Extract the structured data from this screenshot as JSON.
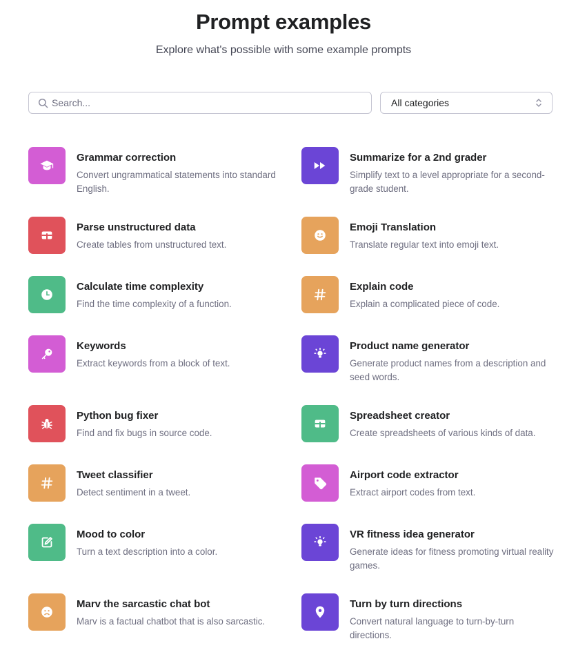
{
  "header": {
    "title": "Prompt examples",
    "subtitle": "Explore what's possible with some example prompts"
  },
  "search": {
    "placeholder": "Search...",
    "value": ""
  },
  "category_filter": {
    "selected": "All categories"
  },
  "colors": {
    "pink": "#d35dd4",
    "red": "#e0525b",
    "green": "#4fbb88",
    "orange": "#e6a35c",
    "purple": "#6b45d6"
  },
  "examples": [
    {
      "title": "Grammar correction",
      "description": "Convert ungrammatical statements into standard English.",
      "icon": "graduation-cap-icon",
      "color": "#d35dd4"
    },
    {
      "title": "Summarize for a 2nd grader",
      "description": "Simplify text to a level appropriate for a second-grade student.",
      "icon": "fast-forward-icon",
      "color": "#6b45d6"
    },
    {
      "title": "Parse unstructured data",
      "description": "Create tables from unstructured text.",
      "icon": "table-icon",
      "color": "#e0525b"
    },
    {
      "title": "Emoji Translation",
      "description": "Translate regular text into emoji text.",
      "icon": "smiley-icon",
      "color": "#e6a35c"
    },
    {
      "title": "Calculate time complexity",
      "description": "Find the time complexity of a function.",
      "icon": "clock-icon",
      "color": "#4fbb88"
    },
    {
      "title": "Explain code",
      "description": "Explain a complicated piece of code.",
      "icon": "hashtag-icon",
      "color": "#e6a35c"
    },
    {
      "title": "Keywords",
      "description": "Extract keywords from a block of text.",
      "icon": "key-icon",
      "color": "#d35dd4"
    },
    {
      "title": "Product name generator",
      "description": "Generate product names from a description and seed words.",
      "icon": "lightbulb-icon",
      "color": "#6b45d6"
    },
    {
      "title": "Python bug fixer",
      "description": "Find and fix bugs in source code.",
      "icon": "bug-icon",
      "color": "#e0525b"
    },
    {
      "title": "Spreadsheet creator",
      "description": "Create spreadsheets of various kinds of data.",
      "icon": "table-icon",
      "color": "#4fbb88"
    },
    {
      "title": "Tweet classifier",
      "description": "Detect sentiment in a tweet.",
      "icon": "hashtag-icon",
      "color": "#e6a35c"
    },
    {
      "title": "Airport code extractor",
      "description": "Extract airport codes from text.",
      "icon": "tag-icon",
      "color": "#d35dd4"
    },
    {
      "title": "Mood to color",
      "description": "Turn a text description into a color.",
      "icon": "edit-icon",
      "color": "#4fbb88"
    },
    {
      "title": "VR fitness idea generator",
      "description": "Generate ideas for fitness promoting virtual reality games.",
      "icon": "lightbulb-icon",
      "color": "#6b45d6"
    },
    {
      "title": "Marv the sarcastic chat bot",
      "description": "Marv is a factual chatbot that is also sarcastic.",
      "icon": "frown-icon",
      "color": "#e6a35c"
    },
    {
      "title": "Turn by turn directions",
      "description": "Convert natural language to turn-by-turn directions.",
      "icon": "map-pin-icon",
      "color": "#6b45d6"
    }
  ]
}
